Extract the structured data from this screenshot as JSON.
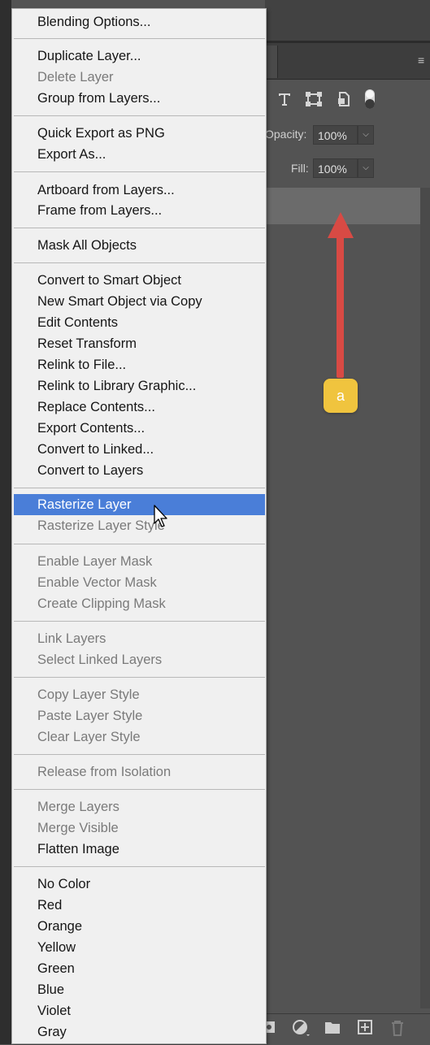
{
  "context_menu": {
    "items": [
      {
        "label": "Blending Options...",
        "enabled": true
      },
      {
        "label": "Duplicate Layer...",
        "enabled": true
      },
      {
        "label": "Delete Layer",
        "enabled": false
      },
      {
        "label": "Group from Layers...",
        "enabled": true
      },
      {
        "label": "Quick Export as PNG",
        "enabled": true
      },
      {
        "label": "Export As...",
        "enabled": true
      },
      {
        "label": "Artboard from Layers...",
        "enabled": true
      },
      {
        "label": "Frame from Layers...",
        "enabled": true
      },
      {
        "label": "Mask All Objects",
        "enabled": true
      },
      {
        "label": "Convert to Smart Object",
        "enabled": true
      },
      {
        "label": "New Smart Object via Copy",
        "enabled": true
      },
      {
        "label": "Edit Contents",
        "enabled": true
      },
      {
        "label": "Reset Transform",
        "enabled": true
      },
      {
        "label": "Relink to File...",
        "enabled": true
      },
      {
        "label": "Relink to Library Graphic...",
        "enabled": true
      },
      {
        "label": "Replace Contents...",
        "enabled": true
      },
      {
        "label": "Export Contents...",
        "enabled": true
      },
      {
        "label": "Convert to Linked...",
        "enabled": true
      },
      {
        "label": "Convert to Layers",
        "enabled": true
      },
      {
        "label": "Rasterize Layer",
        "enabled": true,
        "highlighted": true
      },
      {
        "label": "Rasterize Layer Style",
        "enabled": false
      },
      {
        "label": "Enable Layer Mask",
        "enabled": false
      },
      {
        "label": "Enable Vector Mask",
        "enabled": false
      },
      {
        "label": "Create Clipping Mask",
        "enabled": false
      },
      {
        "label": "Link Layers",
        "enabled": false
      },
      {
        "label": "Select Linked Layers",
        "enabled": false
      },
      {
        "label": "Copy Layer Style",
        "enabled": false
      },
      {
        "label": "Paste Layer Style",
        "enabled": false
      },
      {
        "label": "Clear Layer Style",
        "enabled": false
      },
      {
        "label": "Release from Isolation",
        "enabled": false
      },
      {
        "label": "Merge Layers",
        "enabled": false
      },
      {
        "label": "Merge Visible",
        "enabled": false
      },
      {
        "label": "Flatten Image",
        "enabled": true
      },
      {
        "label": "No Color",
        "enabled": true
      },
      {
        "label": "Red",
        "enabled": true
      },
      {
        "label": "Orange",
        "enabled": true
      },
      {
        "label": "Yellow",
        "enabled": true
      },
      {
        "label": "Green",
        "enabled": true
      },
      {
        "label": "Blue",
        "enabled": true
      },
      {
        "label": "Violet",
        "enabled": true
      },
      {
        "label": "Gray",
        "enabled": true
      }
    ]
  },
  "layers_panel": {
    "opacity_label": "Opacity:",
    "opacity_value": "100%",
    "fill_label": "Fill:",
    "fill_value": "100%",
    "filter_icons": [
      "type-filter-icon",
      "transform-filter-icon",
      "smart-object-filter-icon",
      "filter-toggle-icon"
    ],
    "bottom_icons": [
      "mask-icon",
      "adjustment-layer-icon",
      "new-group-icon",
      "new-layer-icon",
      "delete-layer-icon"
    ]
  },
  "annotation": {
    "badge_label": "a",
    "arrow_color": "#d84a44",
    "badge_color": "#f0c43e"
  },
  "colors": {
    "highlight": "#4a7ed8",
    "menu_bg": "#f0f0f0",
    "panel_bg": "#535353"
  }
}
